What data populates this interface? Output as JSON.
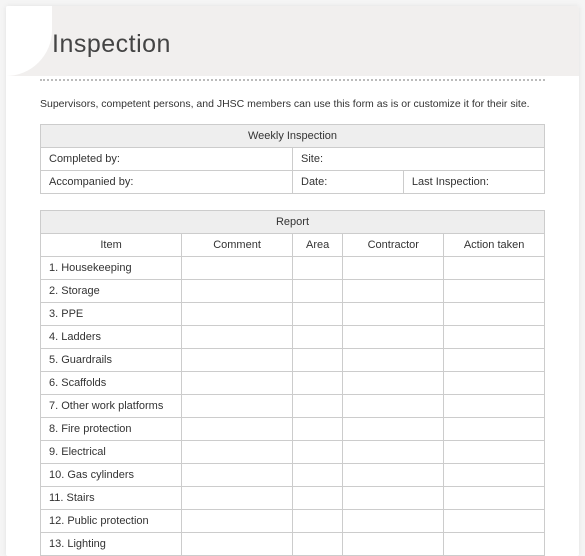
{
  "title": "Inspection",
  "intro": "Supervisors, competent persons, and JHSC members can use this form as is or customize it for their site.",
  "weekly": {
    "header": "Weekly Inspection",
    "completed_by": "Completed by:",
    "site": "Site:",
    "accompanied_by": "Accompanied by:",
    "date": "Date:",
    "last_inspection": "Last Inspection:"
  },
  "report": {
    "header": "Report",
    "columns": [
      "Item",
      "Comment",
      "Area",
      "Contractor",
      "Action taken"
    ],
    "items": [
      "1. Housekeeping",
      "2. Storage",
      "3. PPE",
      "4. Ladders",
      "5. Guardrails",
      "6. Scaffolds",
      "7. Other work platforms",
      "8. Fire protection",
      "9. Electrical",
      "10. Gas cylinders",
      "11. Stairs",
      "12. Public protection",
      "13. Lighting"
    ]
  }
}
